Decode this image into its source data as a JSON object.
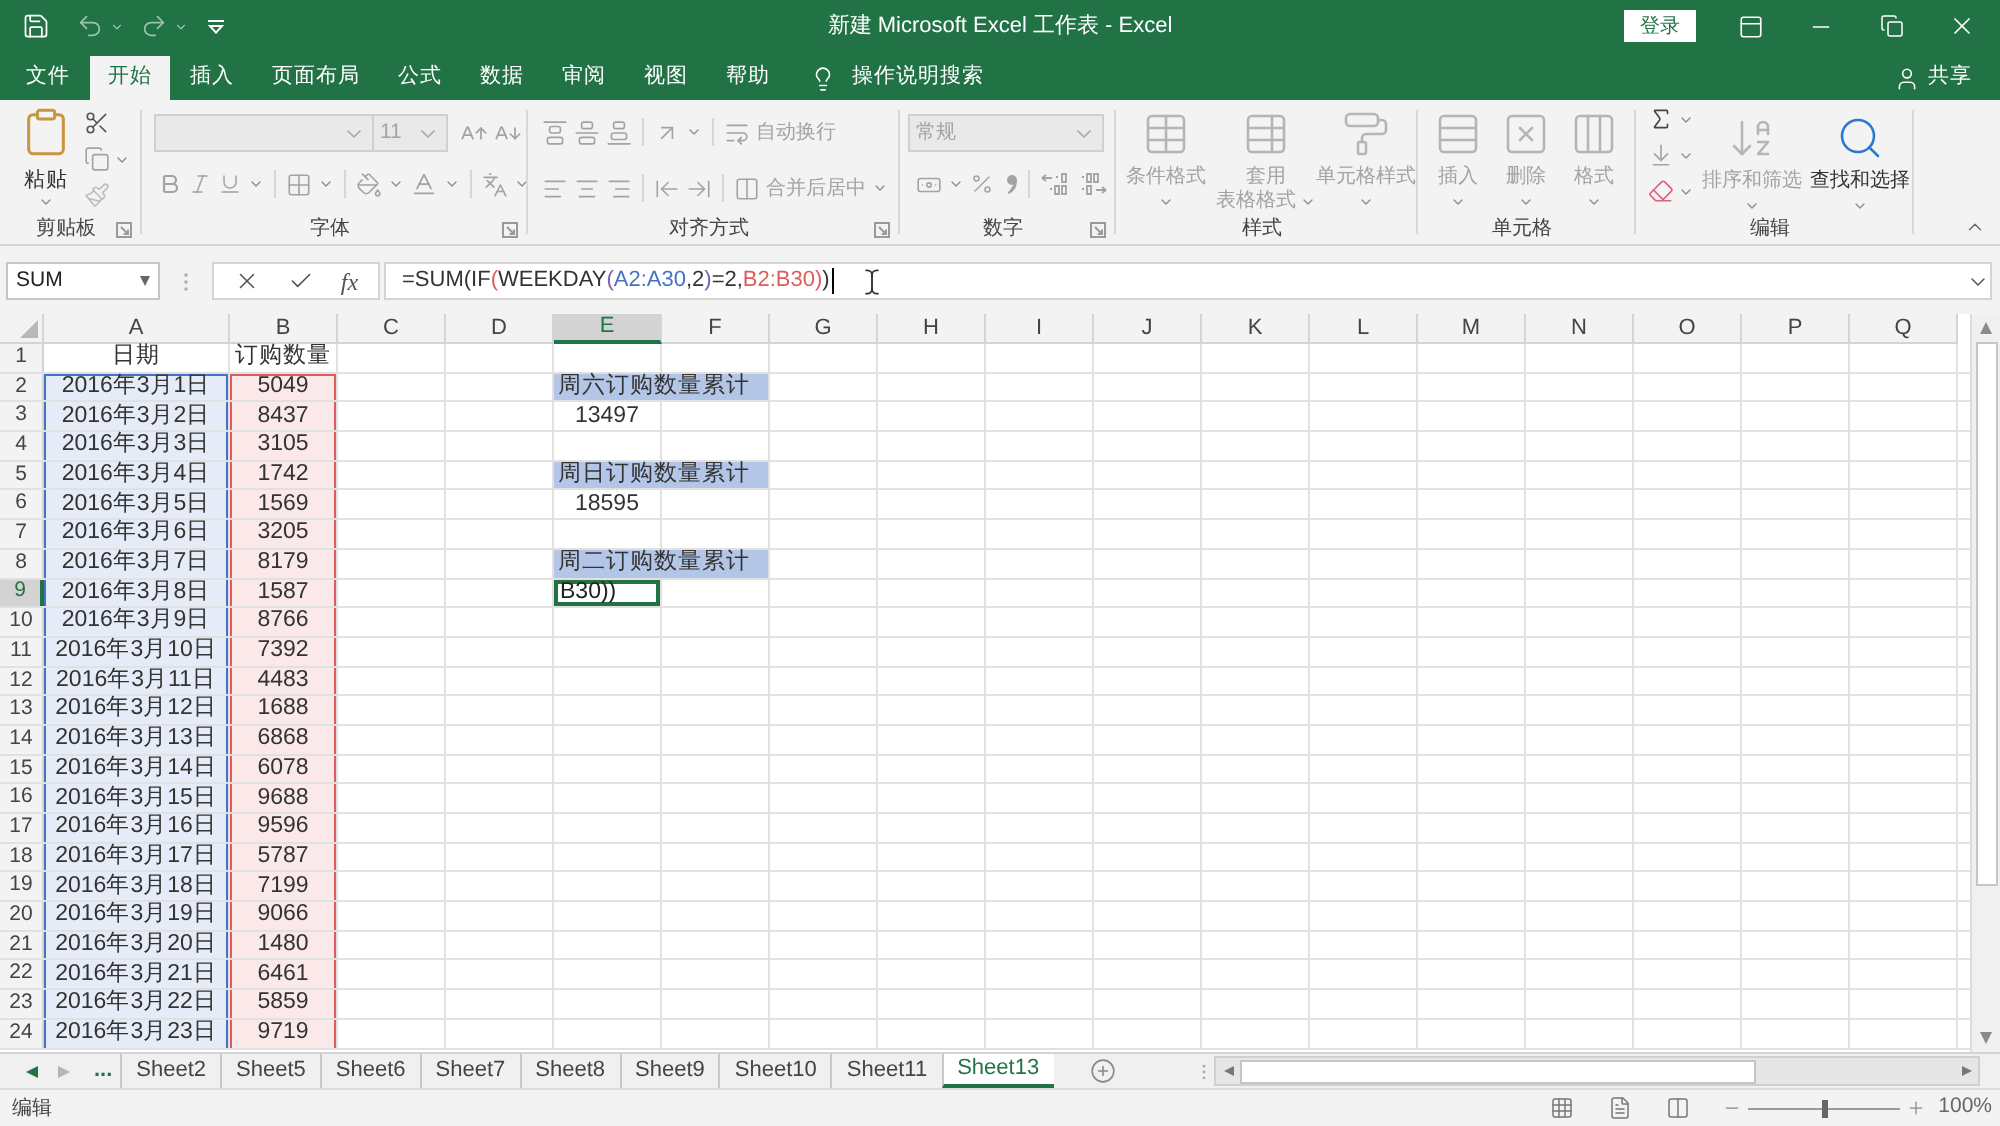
{
  "window": {
    "title": "新建 Microsoft Excel 工作表 - Excel",
    "sign_in": "登录"
  },
  "ribbon_tabs": [
    {
      "label": "文件",
      "selected": false
    },
    {
      "label": "开始",
      "selected": true
    },
    {
      "label": "插入",
      "selected": false
    },
    {
      "label": "页面布局",
      "selected": false
    },
    {
      "label": "公式",
      "selected": false
    },
    {
      "label": "数据",
      "selected": false
    },
    {
      "label": "审阅",
      "selected": false
    },
    {
      "label": "视图",
      "selected": false
    },
    {
      "label": "帮助",
      "selected": false
    }
  ],
  "tell_me": "操作说明搜索",
  "share": "共享",
  "ribbon": {
    "clipboard": {
      "label": "剪贴板",
      "paste": {
        "label": "粘贴",
        "disabled": false
      }
    },
    "font": {
      "label": "字体",
      "name_field": {
        "disabled": true
      },
      "size": {
        "value": "11",
        "disabled": true
      }
    },
    "alignment": {
      "label": "对齐方式",
      "wrap_text": {
        "label": "自动换行",
        "disabled": true
      },
      "merge_center": {
        "label": "合并后居中",
        "disabled": true
      }
    },
    "number": {
      "label": "数字",
      "format": {
        "value": "常规",
        "disabled": true
      }
    },
    "styles": {
      "label": "样式",
      "buttons": [
        {
          "lines": [
            "条件格式"
          ],
          "disabled": true
        },
        {
          "lines": [
            "套用",
            "表格格式"
          ],
          "disabled": true
        },
        {
          "lines": [
            "单元格样式"
          ],
          "disabled": true
        }
      ]
    },
    "cells": {
      "label": "单元格",
      "buttons": [
        {
          "lines": [
            "插入"
          ],
          "disabled": true
        },
        {
          "lines": [
            "删除"
          ],
          "disabled": true
        },
        {
          "lines": [
            "格式"
          ],
          "disabled": true
        }
      ]
    },
    "editing": {
      "label": "编辑",
      "buttons": [
        {
          "lines": [
            "排序和筛选"
          ],
          "disabled": true
        },
        {
          "lines": [
            "查找和选择"
          ],
          "disabled": false
        }
      ]
    }
  },
  "formula_bar": {
    "name_box": "SUM",
    "function_button": "fx",
    "formula": [
      {
        "text": "=SUM(IF",
        "color": "#333333"
      },
      {
        "text": "(",
        "color": "#e05c5c"
      },
      {
        "text": "WEEKDAY",
        "color": "#333333"
      },
      {
        "text": "(",
        "color": "#7a5fb0"
      },
      {
        "text": "A2:A30",
        "color": "#4472c4"
      },
      {
        "text": ",2",
        "color": "#333333"
      },
      {
        "text": ")",
        "color": "#7a5fb0"
      },
      {
        "text": "=2,",
        "color": "#333333"
      },
      {
        "text": "B2:B30)",
        "color": "#e05c5c"
      },
      {
        "text": ")",
        "color": "#333333"
      }
    ]
  },
  "sheet": {
    "columns": [
      {
        "label": "A",
        "selected": false,
        "color": "#4472c4"
      },
      {
        "label": "B",
        "selected": false,
        "color": "#e05c5c"
      },
      {
        "label": "C",
        "selected": false
      },
      {
        "label": "D",
        "selected": false
      },
      {
        "label": "E",
        "selected": true
      },
      {
        "label": "F",
        "selected": false
      },
      {
        "label": "G",
        "selected": false
      },
      {
        "label": "H",
        "selected": false
      },
      {
        "label": "I",
        "selected": false
      },
      {
        "label": "J",
        "selected": false
      },
      {
        "label": "K",
        "selected": false
      },
      {
        "label": "L",
        "selected": false
      },
      {
        "label": "M",
        "selected": false
      },
      {
        "label": "N",
        "selected": false
      },
      {
        "label": "O",
        "selected": false
      },
      {
        "label": "P",
        "selected": false
      },
      {
        "label": "Q",
        "selected": false
      }
    ],
    "rows": [
      {
        "label": "1",
        "selected": false,
        "in_range": false,
        "date": "日期",
        "quantity": "订购数量"
      },
      {
        "label": "2",
        "selected": false,
        "in_range": true,
        "date": "2016年3月1日",
        "quantity": "5049",
        "summary": {
          "kind": "label",
          "text": "周六订购数量累计"
        }
      },
      {
        "label": "3",
        "selected": false,
        "in_range": true,
        "date": "2016年3月2日",
        "quantity": "8437",
        "summary": {
          "kind": "result",
          "text": "13497"
        }
      },
      {
        "label": "4",
        "selected": false,
        "in_range": true,
        "date": "2016年3月3日",
        "quantity": "3105"
      },
      {
        "label": "5",
        "selected": false,
        "in_range": true,
        "date": "2016年3月4日",
        "quantity": "1742",
        "summary": {
          "kind": "label",
          "text": "周日订购数量累计"
        }
      },
      {
        "label": "6",
        "selected": false,
        "in_range": true,
        "date": "2016年3月5日",
        "quantity": "1569",
        "summary": {
          "kind": "result",
          "text": "18595"
        }
      },
      {
        "label": "7",
        "selected": false,
        "in_range": true,
        "date": "2016年3月6日",
        "quantity": "3205"
      },
      {
        "label": "8",
        "selected": false,
        "in_range": true,
        "date": "2016年3月7日",
        "quantity": "8179",
        "summary": {
          "kind": "label",
          "text": "周二订购数量累计"
        }
      },
      {
        "label": "9",
        "selected": true,
        "in_range": true,
        "date": "2016年3月8日",
        "quantity": "1587",
        "summary": {
          "kind": "editing",
          "text": "B30))"
        }
      },
      {
        "label": "10",
        "selected": false,
        "in_range": true,
        "date": "2016年3月9日",
        "quantity": "8766"
      },
      {
        "label": "11",
        "selected": false,
        "in_range": true,
        "date": "2016年3月10日",
        "quantity": "7392"
      },
      {
        "label": "12",
        "selected": false,
        "in_range": true,
        "date": "2016年3月11日",
        "quantity": "4483"
      },
      {
        "label": "13",
        "selected": false,
        "in_range": true,
        "date": "2016年3月12日",
        "quantity": "1688"
      },
      {
        "label": "14",
        "selected": false,
        "in_range": true,
        "date": "2016年3月13日",
        "quantity": "6868"
      },
      {
        "label": "15",
        "selected": false,
        "in_range": true,
        "date": "2016年3月14日",
        "quantity": "6078"
      },
      {
        "label": "16",
        "selected": false,
        "in_range": true,
        "date": "2016年3月15日",
        "quantity": "9688"
      },
      {
        "label": "17",
        "selected": false,
        "in_range": true,
        "date": "2016年3月16日",
        "quantity": "9596"
      },
      {
        "label": "18",
        "selected": false,
        "in_range": true,
        "date": "2016年3月17日",
        "quantity": "5787"
      },
      {
        "label": "19",
        "selected": false,
        "in_range": true,
        "date": "2016年3月18日",
        "quantity": "7199"
      },
      {
        "label": "20",
        "selected": false,
        "in_range": true,
        "date": "2016年3月19日",
        "quantity": "9066"
      },
      {
        "label": "21",
        "selected": false,
        "in_range": true,
        "date": "2016年3月20日",
        "quantity": "1480"
      },
      {
        "label": "22",
        "selected": false,
        "in_range": true,
        "date": "2016年3月21日",
        "quantity": "6461"
      },
      {
        "label": "23",
        "selected": false,
        "in_range": true,
        "date": "2016年3月22日",
        "quantity": "5859"
      },
      {
        "label": "24",
        "selected": false,
        "in_range": true,
        "date": "2016年3月23日",
        "quantity": "9719"
      }
    ]
  },
  "sheet_tabs": {
    "more": "...",
    "tabs": [
      {
        "label": "Sheet2",
        "selected": false
      },
      {
        "label": "Sheet5",
        "selected": false
      },
      {
        "label": "Sheet6",
        "selected": false
      },
      {
        "label": "Sheet7",
        "selected": false
      },
      {
        "label": "Sheet8",
        "selected": false
      },
      {
        "label": "Sheet9",
        "selected": false
      },
      {
        "label": "Sheet10",
        "selected": false
      },
      {
        "label": "Sheet11",
        "selected": false
      },
      {
        "label": "Sheet13",
        "selected": true
      }
    ]
  },
  "status_bar": {
    "mode": "编辑",
    "zoom": {
      "level": 0.5,
      "reading": "100%"
    }
  }
}
